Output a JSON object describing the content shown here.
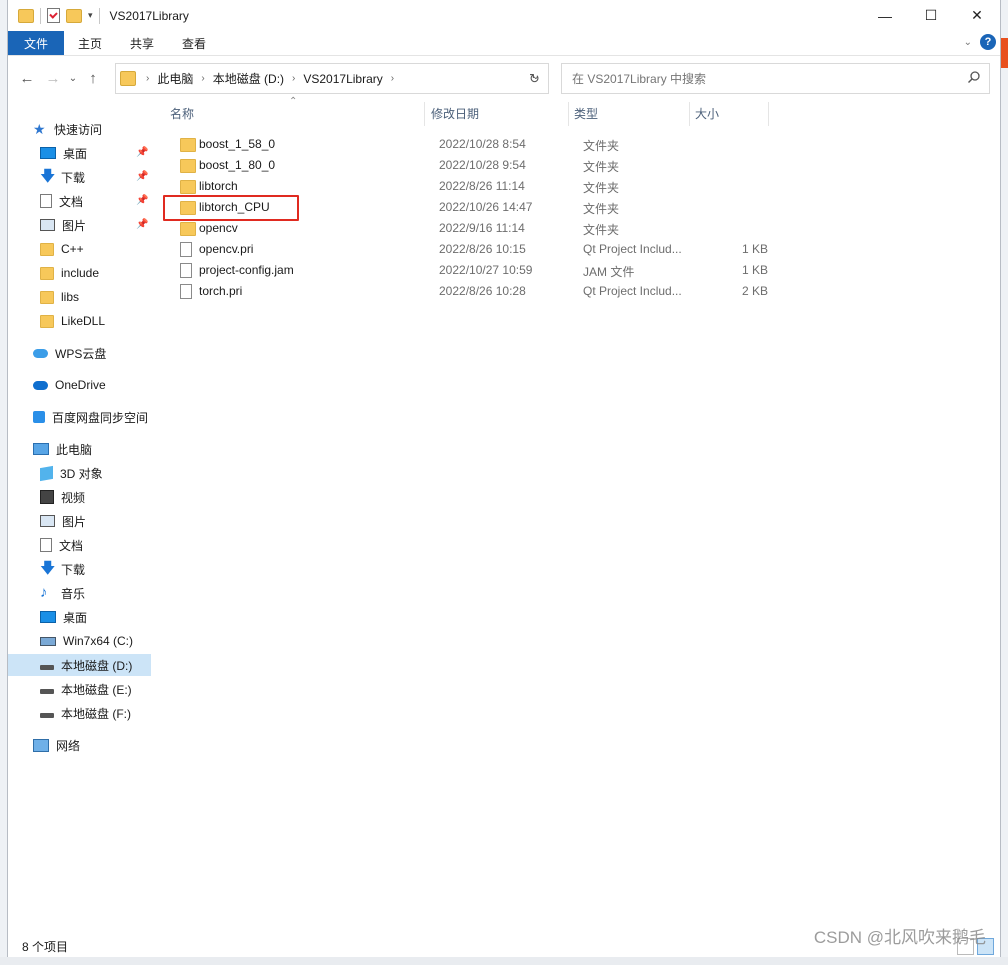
{
  "window": {
    "title": "VS2017Library",
    "controls": {
      "minimize": "—",
      "maximize": "☐",
      "close": "✕"
    }
  },
  "ribbon": {
    "tabs": [
      "文件",
      "主页",
      "共享",
      "查看"
    ],
    "help": "?"
  },
  "nav": {
    "breadcrumb": [
      "此电脑",
      "本地磁盘 (D:)",
      "VS2017Library"
    ],
    "search_placeholder": "在 VS2017Library 中搜索"
  },
  "sidebar": {
    "quick_access": "快速访问",
    "quick_items": [
      {
        "label": "桌面",
        "icon": "desktop-icon",
        "pinned": true
      },
      {
        "label": "下载",
        "icon": "download-icon",
        "pinned": true
      },
      {
        "label": "文档",
        "icon": "document-icon",
        "pinned": true
      },
      {
        "label": "图片",
        "icon": "pictures-icon",
        "pinned": true
      },
      {
        "label": "C++",
        "icon": "folder-icon",
        "pinned": false
      },
      {
        "label": "include",
        "icon": "folder-icon",
        "pinned": false
      },
      {
        "label": "libs",
        "icon": "folder-icon",
        "pinned": false
      },
      {
        "label": "LikeDLL",
        "icon": "folder-icon",
        "pinned": false
      }
    ],
    "wps": "WPS云盘",
    "onedrive": "OneDrive",
    "baidu": "百度网盘同步空间",
    "this_pc": "此电脑",
    "pc_items": [
      {
        "label": "3D 对象",
        "icon": "3d-objects-icon"
      },
      {
        "label": "视频",
        "icon": "video-icon"
      },
      {
        "label": "图片",
        "icon": "pictures-icon"
      },
      {
        "label": "文档",
        "icon": "document-icon"
      },
      {
        "label": "下载",
        "icon": "download-icon"
      },
      {
        "label": "音乐",
        "icon": "music-icon"
      },
      {
        "label": "桌面",
        "icon": "desktop-icon"
      },
      {
        "label": "Win7x64 (C:)",
        "icon": "system-drive-icon"
      },
      {
        "label": "本地磁盘 (D:)",
        "icon": "drive-icon"
      },
      {
        "label": "本地磁盘 (E:)",
        "icon": "drive-icon"
      },
      {
        "label": "本地磁盘 (F:)",
        "icon": "drive-icon"
      }
    ],
    "network": "网络"
  },
  "columns": {
    "name": "名称",
    "modified": "修改日期",
    "type": "类型",
    "size": "大小"
  },
  "files": [
    {
      "name": "boost_1_58_0",
      "modified": "2022/10/28 8:54",
      "type": "文件夹",
      "size": "",
      "kind": "folder"
    },
    {
      "name": "boost_1_80_0",
      "modified": "2022/10/28 9:54",
      "type": "文件夹",
      "size": "",
      "kind": "folder"
    },
    {
      "name": "libtorch",
      "modified": "2022/8/26 11:14",
      "type": "文件夹",
      "size": "",
      "kind": "folder"
    },
    {
      "name": "libtorch_CPU",
      "modified": "2022/10/26 14:47",
      "type": "文件夹",
      "size": "",
      "kind": "folder"
    },
    {
      "name": "opencv",
      "modified": "2022/9/16 11:14",
      "type": "文件夹",
      "size": "",
      "kind": "folder"
    },
    {
      "name": "opencv.pri",
      "modified": "2022/8/26 10:15",
      "type": "Qt Project Includ...",
      "size": "1 KB",
      "kind": "file"
    },
    {
      "name": "project-config.jam",
      "modified": "2022/10/27 10:59",
      "type": "JAM 文件",
      "size": "1 KB",
      "kind": "file"
    },
    {
      "name": "torch.pri",
      "modified": "2022/8/26 10:28",
      "type": "Qt Project Includ...",
      "size": "2 KB",
      "kind": "file"
    }
  ],
  "status": {
    "count": "8 个项目"
  },
  "watermark": "CSDN @北风吹来鹅毛",
  "colors": {
    "accent": "#1a65b7",
    "selection": "#cce4f7",
    "highlight_box": "#e02a20",
    "folder": "#f7c85a"
  }
}
